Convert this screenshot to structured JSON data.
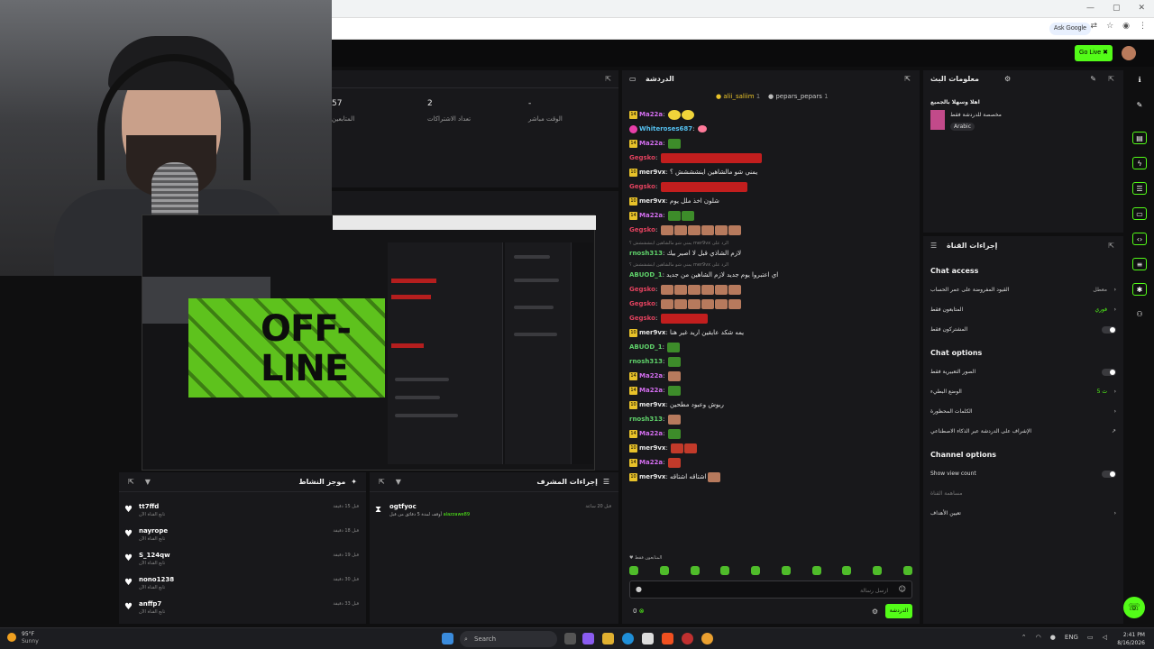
{
  "browser": {
    "ask_google": "Ask Google",
    "window_controls": [
      "—",
      "▢",
      "✕"
    ]
  },
  "header": {
    "go_live": "Go Live",
    "go_live_icon": "kick-icon"
  },
  "stats": {
    "values": [
      "57",
      "2",
      "-"
    ],
    "labels": [
      "المتابعين",
      "تعداد الاشتراكات",
      "الوقت مباشر"
    ]
  },
  "preview": {
    "offline_line1": "OFF-",
    "offline_line2": "LINE"
  },
  "activity": {
    "title": "موجز النشاط",
    "items": [
      {
        "user": "tt7ffd",
        "sub": "تابع القناة الآن",
        "time": "قبل 15 دقيقة"
      },
      {
        "user": "nayrope",
        "sub": "تابع القناة الآن",
        "time": "قبل 18 دقيقة"
      },
      {
        "user": "S_124qw",
        "sub": "تابع القناة الآن",
        "time": "قبل 19 دقيقة"
      },
      {
        "user": "nono1238",
        "sub": "تابع القناة الآن",
        "time": "قبل 30 دقيقة"
      },
      {
        "user": "anffp7",
        "sub": "تابع القناة الآن",
        "time": "قبل 33 دقيقة"
      }
    ]
  },
  "mod": {
    "title": "إجراءات المشرف",
    "user": "ogtfyoc",
    "action": "أوقف لمدة 5 دقائق من قبل",
    "by": "alazzawe89",
    "time": "قبل 20 ساعة"
  },
  "chat": {
    "title": "الدردشة",
    "pinned": [
      {
        "name": "alii_saliim",
        "count": "1"
      },
      {
        "name": "pepars_pepars",
        "count": "1"
      }
    ],
    "messages": [
      {
        "name": "Ma22a",
        "color": "#d46ef0",
        "badge": "14",
        "text": ""
      },
      {
        "name": "Whiteroses687",
        "color": "#55c0f0",
        "badge": "pink",
        "text": ""
      },
      {
        "name": "Ma22a",
        "color": "#d46ef0",
        "badge": "14",
        "text": ""
      },
      {
        "name": "Gegsko",
        "color": "#e0425e",
        "badge": "",
        "text": ""
      },
      {
        "name": "mer9vx",
        "color": "#e8e8e8",
        "badge": "10",
        "text": "يمني شو مالشاهين اينشششش ؟"
      },
      {
        "name": "Gegsko",
        "color": "#e0425e",
        "badge": "",
        "text": ""
      },
      {
        "name": "mer9vx",
        "color": "#e8e8e8",
        "badge": "10",
        "text": "شلون اخذ ملل يوم"
      },
      {
        "name": "Ma22a",
        "color": "#d46ef0",
        "badge": "14",
        "text": ""
      },
      {
        "name": "Gegsko",
        "color": "#e0425e",
        "badge": "",
        "text": ""
      },
      {
        "name": "rnosh313",
        "color": "#5fd16a",
        "badge": "",
        "text": "لازم الشاذي قبل لا اصير بيك"
      },
      {
        "name": "ABUOD_1",
        "color": "#5fd16a",
        "badge": "",
        "text": "اي اعتبروا يوم جديد لازم الشاهين من جديد"
      },
      {
        "name": "Gegsko",
        "color": "#e0425e",
        "badge": "",
        "text": ""
      },
      {
        "name": "Gegsko",
        "color": "#e0425e",
        "badge": "",
        "text": ""
      },
      {
        "name": "Gegsko",
        "color": "#e0425e",
        "badge": "",
        "text": ""
      },
      {
        "name": "mer9vx",
        "color": "#e8e8e8",
        "badge": "10",
        "text": "يمه شكد عايقين اريد غير هنا"
      },
      {
        "name": "ABUOD_1",
        "color": "#5fd16a",
        "badge": "",
        "text": ""
      },
      {
        "name": "rnosh313",
        "color": "#5fd16a",
        "badge": "",
        "text": ""
      },
      {
        "name": "Ma22a",
        "color": "#d46ef0",
        "badge": "14",
        "text": ""
      },
      {
        "name": "Ma22a",
        "color": "#d46ef0",
        "badge": "14",
        "text": ""
      },
      {
        "name": "mer9vx",
        "color": "#e8e8e8",
        "badge": "10",
        "text": "ربوش وعبود مطحين"
      },
      {
        "name": "rnosh313",
        "color": "#5fd16a",
        "badge": "",
        "text": ""
      },
      {
        "name": "Ma22a",
        "color": "#d46ef0",
        "badge": "14",
        "text": ""
      },
      {
        "name": "mer9vx",
        "color": "#e8e8e8",
        "badge": "10",
        "text": ""
      },
      {
        "name": "Ma22a",
        "color": "#d46ef0",
        "badge": "14",
        "text": ""
      },
      {
        "name": "mer9vx",
        "color": "#e8e8e8",
        "badge": "10",
        "text": "اشتاقه اشتاقه"
      }
    ],
    "replies": [
      "يمني شو مالشاهين اينشششش ؟ mer9vx الرد على",
      "يمني شو مالشاهين اينشششش ؟ mer9vx الرد على"
    ],
    "followers_only": "المتابعون فقط",
    "input_placeholder": "ارسل رسالة",
    "count": "0",
    "send_label": "الدردشة"
  },
  "stream_info": {
    "title": "معلومات البث",
    "stream_title": "اهلا وسهلا بالجميع",
    "category": "مخصصة للدردشة فقط",
    "language": "Arabic"
  },
  "channel_actions": {
    "title": "إجراءات القناة",
    "chat_access": "Chat access",
    "access_rows": [
      {
        "label": "القيود المفروضة على عمر الحساب",
        "value": "معطل",
        "type": "chevron"
      },
      {
        "label": "المتابعون فقط",
        "value": "فوري",
        "type": "chevron"
      },
      {
        "label": "المشتركون فقط",
        "value": "",
        "type": "toggle"
      }
    ],
    "chat_options": "Chat options",
    "option_rows": [
      {
        "label": "الصور التعبيرية فقط",
        "value": "",
        "type": "toggle"
      },
      {
        "label": "الوضع البطيء",
        "value": "5 ث",
        "type": "chevron"
      },
      {
        "label": "الكلمات المحظورة",
        "value": "",
        "type": "chevron"
      },
      {
        "label": "الإشراف على الدردشة عبر الذكاء الاصطناعي",
        "value": "",
        "type": "external"
      }
    ],
    "channel_options": "Channel options",
    "show_view_count": "Show view count",
    "channel_help": "مساهمة القناة",
    "goals": "تعيين الأهداف"
  },
  "taskbar": {
    "temp": "95°F",
    "weather": "Sunny",
    "search": "Search",
    "lang": "ENG",
    "time": "2:41 PM",
    "date": "8/16/2026"
  },
  "colors": {
    "accent": "#53fc18",
    "panel": "#18181b",
    "bg": "#0f0f10"
  }
}
